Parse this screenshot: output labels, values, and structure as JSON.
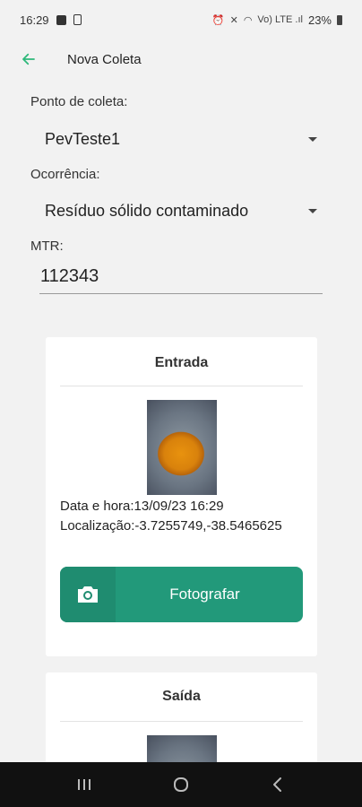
{
  "status_bar": {
    "time": "16:29",
    "battery": "23%",
    "signal": "Vo) LTE .ıl"
  },
  "app_bar": {
    "title": "Nova Coleta",
    "back_icon": "arrow-left-icon",
    "accent_color": "#2eb87a"
  },
  "form": {
    "ponto_label": "Ponto de coleta:",
    "ponto_value": "PevTeste1",
    "ocorrencia_label": "Ocorrência:",
    "ocorrencia_value": "Resíduo sólido contaminado",
    "mtr_label": "MTR:",
    "mtr_value": "112343"
  },
  "entrada": {
    "title": "Entrada",
    "datetime": "Data e hora:13/09/23 16:29",
    "location": "Localização:-3.7255749,-38.5465625",
    "button_label": "Fotografar",
    "button_icon": "camera-icon",
    "button_color": "#22997a"
  },
  "saida": {
    "title": "Saída"
  },
  "nav_bar": {
    "recents_icon": "recents-icon",
    "home_icon": "home-icon",
    "back_icon": "back-chevron-icon"
  }
}
